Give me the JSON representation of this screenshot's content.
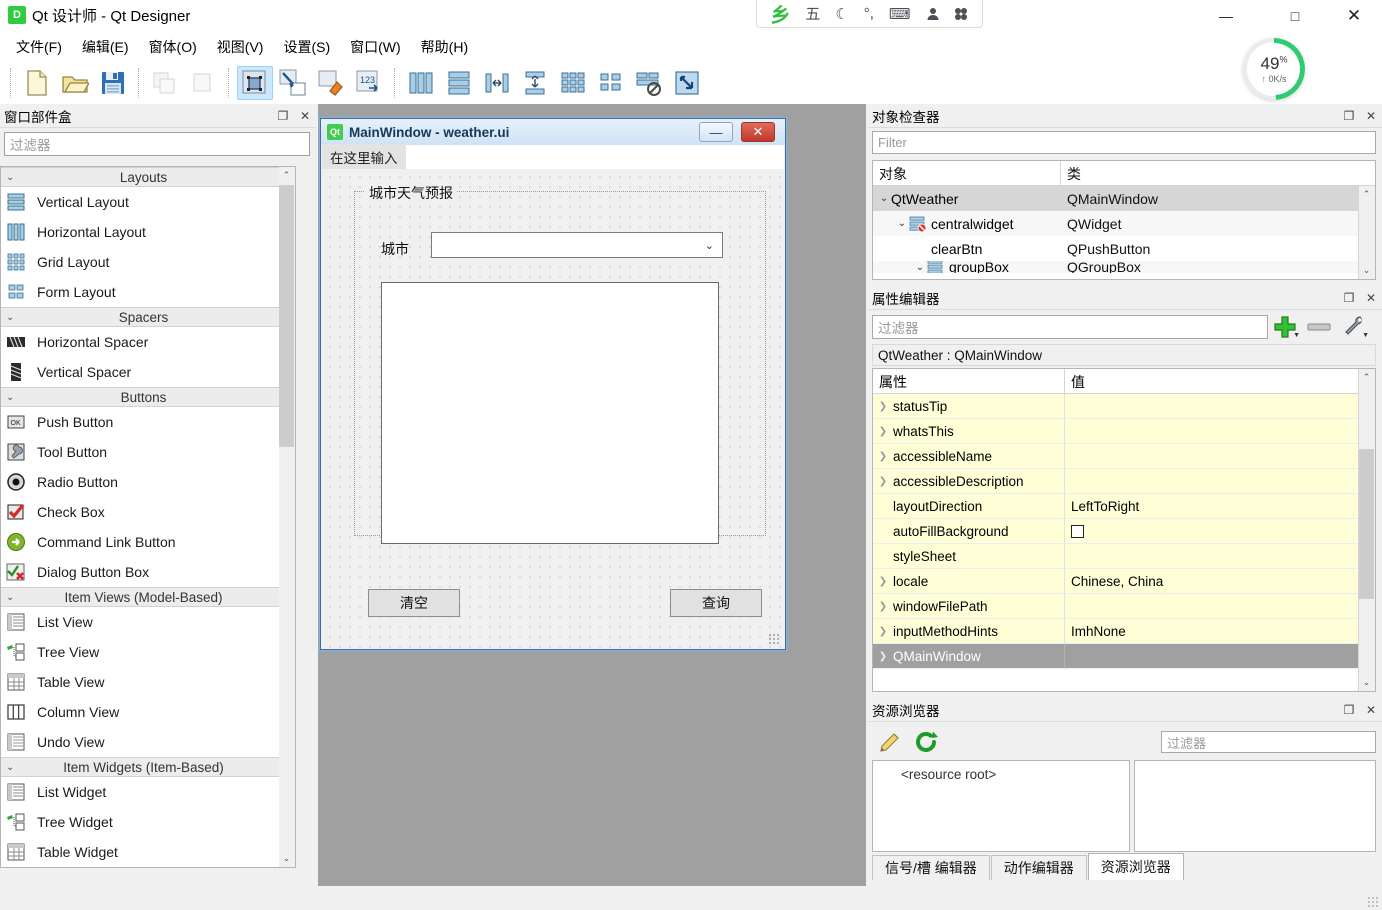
{
  "window": {
    "app_icon": "D",
    "title": "Qt 设计师 - Qt Designer",
    "minimize": "—",
    "maximize": "□",
    "close": "✕"
  },
  "menubar": {
    "items": [
      {
        "label": "文件(F)",
        "name": "menu-file"
      },
      {
        "label": "编辑(E)",
        "name": "menu-edit"
      },
      {
        "label": "窗体(O)",
        "name": "menu-form"
      },
      {
        "label": "视图(V)",
        "name": "menu-view"
      },
      {
        "label": "设置(S)",
        "name": "menu-settings"
      },
      {
        "label": "窗口(W)",
        "name": "menu-window"
      },
      {
        "label": "帮助(H)",
        "name": "menu-help"
      }
    ]
  },
  "toolbar": {
    "groups": [
      {
        "buttons": [
          {
            "name": "new-form-icon",
            "state": "normal"
          },
          {
            "name": "open-form-icon",
            "state": "normal"
          },
          {
            "name": "save-form-icon",
            "state": "normal"
          }
        ]
      },
      {
        "buttons": [
          {
            "name": "undo-icon",
            "state": "disabled"
          },
          {
            "name": "redo-icon",
            "state": "disabled"
          }
        ]
      },
      {
        "buttons": [
          {
            "name": "edit-widgets-icon",
            "state": "active"
          },
          {
            "name": "edit-signals-slots-icon",
            "state": "normal"
          },
          {
            "name": "edit-buddies-icon",
            "state": "normal"
          },
          {
            "name": "edit-tab-order-icon",
            "state": "normal"
          }
        ]
      },
      {
        "buttons": [
          {
            "name": "layout-horizontally-icon",
            "state": "normal"
          },
          {
            "name": "layout-vertically-icon",
            "state": "normal"
          },
          {
            "name": "layout-horizontal-splitter-icon",
            "state": "normal"
          },
          {
            "name": "layout-vertical-splitter-icon",
            "state": "normal"
          },
          {
            "name": "layout-grid-icon",
            "state": "normal"
          },
          {
            "name": "layout-form-icon",
            "state": "normal"
          },
          {
            "name": "break-layout-icon",
            "state": "normal"
          },
          {
            "name": "adjust-size-icon",
            "state": "normal"
          }
        ]
      }
    ]
  },
  "ime_bar": {
    "items": [
      {
        "name": "sogou-logo-icon",
        "glyph": "乡"
      },
      {
        "name": "chinese-mode-icon",
        "glyph": "五"
      },
      {
        "name": "moon-icon",
        "glyph": "☾"
      },
      {
        "name": "punctuation-icon",
        "glyph": "°,"
      },
      {
        "name": "soft-keyboard-icon",
        "glyph": "⌨"
      },
      {
        "name": "user-icon",
        "glyph": "👤"
      },
      {
        "name": "toolbox-icon",
        "glyph": "⣿"
      }
    ]
  },
  "network_monitor": {
    "percent": "49",
    "percent_unit": "%",
    "rate": "0K/s",
    "arrow": "↑",
    "ring_color": "#2ecc71"
  },
  "widget_box": {
    "title": "窗口部件盒",
    "float_btn": "❐",
    "close_btn": "✕",
    "filter_placeholder": "过滤器",
    "categories": [
      {
        "label": "Layouts",
        "items": [
          {
            "label": "Vertical Layout",
            "icon": "vertical-layout-icon"
          },
          {
            "label": "Horizontal Layout",
            "icon": "horizontal-layout-icon"
          },
          {
            "label": "Grid Layout",
            "icon": "grid-layout-icon"
          },
          {
            "label": "Form Layout",
            "icon": "form-layout-icon"
          }
        ]
      },
      {
        "label": "Spacers",
        "items": [
          {
            "label": "Horizontal Spacer",
            "icon": "horizontal-spacer-icon"
          },
          {
            "label": "Vertical Spacer",
            "icon": "vertical-spacer-icon"
          }
        ]
      },
      {
        "label": "Buttons",
        "items": [
          {
            "label": "Push Button",
            "icon": "push-button-icon"
          },
          {
            "label": "Tool Button",
            "icon": "tool-button-icon"
          },
          {
            "label": "Radio Button",
            "icon": "radio-button-icon"
          },
          {
            "label": "Check Box",
            "icon": "check-box-icon"
          },
          {
            "label": "Command Link Button",
            "icon": "command-link-button-icon"
          },
          {
            "label": "Dialog Button Box",
            "icon": "dialog-button-box-icon"
          }
        ]
      },
      {
        "label": "Item Views (Model-Based)",
        "items": [
          {
            "label": "List View",
            "icon": "list-view-icon"
          },
          {
            "label": "Tree View",
            "icon": "tree-view-icon"
          },
          {
            "label": "Table View",
            "icon": "table-view-icon"
          },
          {
            "label": "Column View",
            "icon": "column-view-icon"
          },
          {
            "label": "Undo View",
            "icon": "undo-view-icon"
          }
        ]
      },
      {
        "label": "Item Widgets (Item-Based)",
        "items": [
          {
            "label": "List Widget",
            "icon": "list-widget-icon"
          },
          {
            "label": "Tree Widget",
            "icon": "tree-widget-icon"
          },
          {
            "label": "Table Widget",
            "icon": "table-widget-icon"
          }
        ]
      }
    ]
  },
  "form": {
    "title": "MainWindow - weather.ui",
    "qt_icon": "Qt",
    "minimize": "—",
    "close": "✕",
    "menu_placeholder": "在这里输入",
    "group_title": "城市天气预报",
    "city_label": "城市",
    "city_value": "",
    "result_value": "",
    "clear_button": "清空",
    "query_button": "查询"
  },
  "object_inspector": {
    "title": "对象检查器",
    "float_btn": "❐",
    "close_btn": "✕",
    "filter_placeholder": "Filter",
    "columns": [
      "对象",
      "类"
    ],
    "rows": [
      {
        "name": "QtWeather",
        "class": "QMainWindow",
        "indent": 0,
        "expanded": true,
        "selected": true,
        "has_icon": false
      },
      {
        "name": "centralwidget",
        "class": "QWidget",
        "indent": 1,
        "expanded": true,
        "selected": false,
        "has_icon": true
      },
      {
        "name": "clearBtn",
        "class": "QPushButton",
        "indent": 2,
        "expanded": false,
        "selected": false,
        "has_icon": false
      },
      {
        "name": "groupBox",
        "class": "QGroupBox",
        "indent": 2,
        "expanded": true,
        "selected": false,
        "has_icon": true
      }
    ]
  },
  "property_editor": {
    "title": "属性编辑器",
    "float_btn": "❐",
    "close_btn": "✕",
    "filter_placeholder": "过滤器",
    "add_icon": "plus-icon",
    "remove_icon": "minus-icon",
    "config_icon": "wrench-icon",
    "object_line": "QtWeather : QMainWindow",
    "columns": [
      "属性",
      "值"
    ],
    "rows": [
      {
        "name": "statusTip",
        "value": "",
        "expandable": true,
        "highlight": true,
        "selected": false,
        "checkbox": false
      },
      {
        "name": "whatsThis",
        "value": "",
        "expandable": true,
        "highlight": true,
        "selected": false,
        "checkbox": false
      },
      {
        "name": "accessibleName",
        "value": "",
        "expandable": true,
        "highlight": true,
        "selected": false,
        "checkbox": false
      },
      {
        "name": "accessibleDescription",
        "value": "",
        "expandable": true,
        "highlight": true,
        "selected": false,
        "checkbox": false
      },
      {
        "name": "layoutDirection",
        "value": "LeftToRight",
        "expandable": false,
        "highlight": true,
        "selected": false,
        "checkbox": false
      },
      {
        "name": "autoFillBackground",
        "value": "",
        "expandable": false,
        "highlight": true,
        "selected": false,
        "checkbox": true
      },
      {
        "name": "styleSheet",
        "value": "",
        "expandable": false,
        "highlight": true,
        "selected": false,
        "checkbox": false
      },
      {
        "name": "locale",
        "value": "Chinese, China",
        "expandable": true,
        "highlight": true,
        "selected": false,
        "checkbox": false
      },
      {
        "name": "windowFilePath",
        "value": "",
        "expandable": true,
        "highlight": true,
        "selected": false,
        "checkbox": false
      },
      {
        "name": "inputMethodHints",
        "value": "ImhNone",
        "expandable": true,
        "highlight": true,
        "selected": false,
        "checkbox": false
      },
      {
        "name": "QMainWindow",
        "value": "",
        "expandable": true,
        "highlight": false,
        "selected": true,
        "checkbox": false
      }
    ]
  },
  "resource_browser": {
    "title": "资源浏览器",
    "float_btn": "❐",
    "close_btn": "✕",
    "edit_icon": "pencil-icon",
    "reload_icon": "reload-icon",
    "filter_placeholder": "过滤器",
    "tree_root": "<resource root>",
    "tabs": [
      {
        "label": "信号/槽 编辑器",
        "active": false
      },
      {
        "label": "动作编辑器",
        "active": false
      },
      {
        "label": "资源浏览器",
        "active": true
      }
    ]
  }
}
